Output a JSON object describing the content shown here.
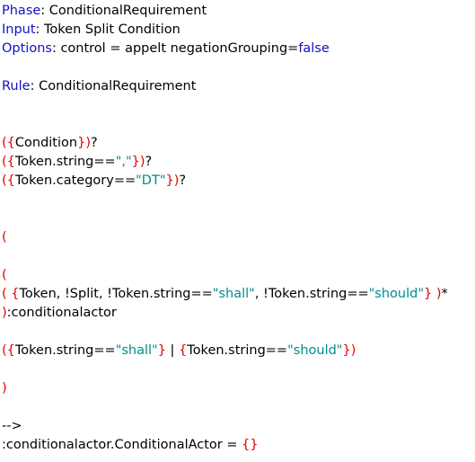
{
  "colors": {
    "keyword": "#1010c0",
    "bracket": "#e00000",
    "string": "#008b8b",
    "text": "#000000"
  },
  "header": {
    "phase_kw": "Phase",
    "phase_val": ": ConditionalRequirement",
    "input_kw": "Input",
    "input_val": ": Token Split Condition",
    "options_kw": "Options",
    "options_val": ": control = appelt negationGrouping=",
    "options_false": "false"
  },
  "rule": {
    "kw": "Rule",
    "val": ": ConditionalRequirement"
  },
  "lhs": {
    "cond_open": "({",
    "cond_text": "Condition",
    "cond_close": "})",
    "cond_q": "?",
    "tok_open": "({",
    "tok_text": "Token.string==",
    "tok_str": "\",\"",
    "tok_close": "})",
    "tok_q": "?",
    "cat_open": "({",
    "cat_text": "Token.category==",
    "cat_str": "\"DT\"",
    "cat_close": "})",
    "cat_q": "?",
    "paren_open1": "(",
    "paren_open2": "(",
    "actor_open_paren": "(",
    "actor_open_brace": "{",
    "actor_text1": "Token, !Split, !Token.string==",
    "actor_str1": "\"shall\"",
    "actor_text2": ", !Token.string==",
    "actor_str2": "\"should\"",
    "actor_close_brace": "}",
    "actor_close_paren": ")",
    "actor_star": "*",
    "actor_label_paren": ")",
    "actor_label": ":conditionalactor",
    "alt_open": "({",
    "alt_text1": "Token.string==",
    "alt_str1": "\"shall\"",
    "alt_mid_close": "}",
    "alt_pipe": " | ",
    "alt_mid_open": "{",
    "alt_text2": "Token.string==",
    "alt_str2": "\"should\"",
    "alt_close": "})",
    "paren_close": ")"
  },
  "rhs": {
    "arrow": "-->",
    "action": ":conditionalactor.ConditionalActor = ",
    "braces": "{}"
  }
}
